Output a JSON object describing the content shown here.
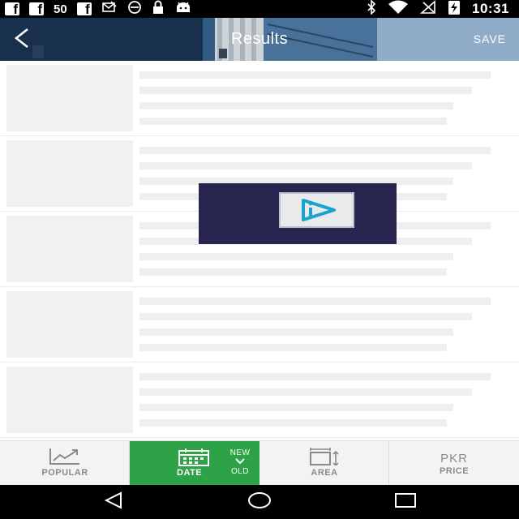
{
  "status_bar": {
    "left_icons": [
      "facebook-icon",
      "facebook-icon",
      "facebook-icon",
      "email-icon",
      "sync-icon",
      "lock-icon",
      "android-icon"
    ],
    "fb_glyph": "f",
    "notification_count": "50",
    "right_icons": [
      "bluetooth-icon",
      "wifi-icon",
      "no-signal-icon",
      "battery-charging-icon"
    ],
    "time": "10:31"
  },
  "header": {
    "title": "Results",
    "save_label": "SAVE",
    "back_icon": "chevron-left-icon"
  },
  "list": {
    "placeholder_rows": 5
  },
  "loader": {
    "icon": "play-logo-icon",
    "colors": {
      "background": "#27244f",
      "accent": "#1aa3cf"
    }
  },
  "sort_bar": {
    "popular_label": "POPULAR",
    "date_label": "DATE",
    "date_order_new": "NEW",
    "date_order_old": "OLD",
    "area_label": "AREA",
    "price_currency": "PKR",
    "price_label": "PRICE",
    "active": "DATE",
    "colors": {
      "active_bg": "#2ea246",
      "inactive_text": "#8a8a8a"
    }
  },
  "nav_bar": {
    "buttons": [
      "back-triangle-icon",
      "home-circle-icon",
      "recents-square-icon"
    ]
  }
}
